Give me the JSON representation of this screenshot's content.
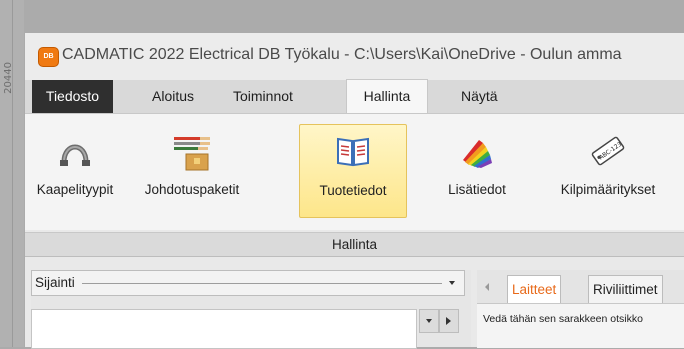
{
  "ruler": {
    "label": "20440"
  },
  "window": {
    "title": "CADMATIC 2022 Electrical DB Työkalu - C:\\Users\\Kai\\OneDrive - Oulun amma",
    "icon_text": "DB"
  },
  "menu": {
    "items": [
      {
        "label": "Tiedosto"
      },
      {
        "label": "Aloitus"
      },
      {
        "label": "Toiminnot"
      },
      {
        "label": "Hallinta"
      },
      {
        "label": "Näytä"
      }
    ],
    "active": "Hallinta"
  },
  "ribbon": {
    "buttons": [
      {
        "label": "Kaapelityypit",
        "icon": "cable-icon"
      },
      {
        "label": "Johdotuspaketit",
        "icon": "wire-package-icon"
      },
      {
        "label": "Tuotetiedot",
        "icon": "book-icon",
        "selected": true
      },
      {
        "label": "Lisätiedot",
        "icon": "color-palette-icon"
      },
      {
        "label": "Kilpimääritykset",
        "icon": "label-tag-icon"
      }
    ],
    "group_label": "Hallinta",
    "tag_icon_text": "ABC-123"
  },
  "left_panel": {
    "dropdown_label": "Sijainti"
  },
  "right_panel": {
    "tabs": [
      {
        "label": "Laitteet",
        "active": true
      },
      {
        "label": "Riviliittimet"
      }
    ],
    "group_hint": "Vedä tähän sen sarakkeen otsikko"
  },
  "colors": {
    "accent": "#e86a1a",
    "menu_file_bg": "#2f2f2f",
    "selected_button": "#fde68a"
  }
}
